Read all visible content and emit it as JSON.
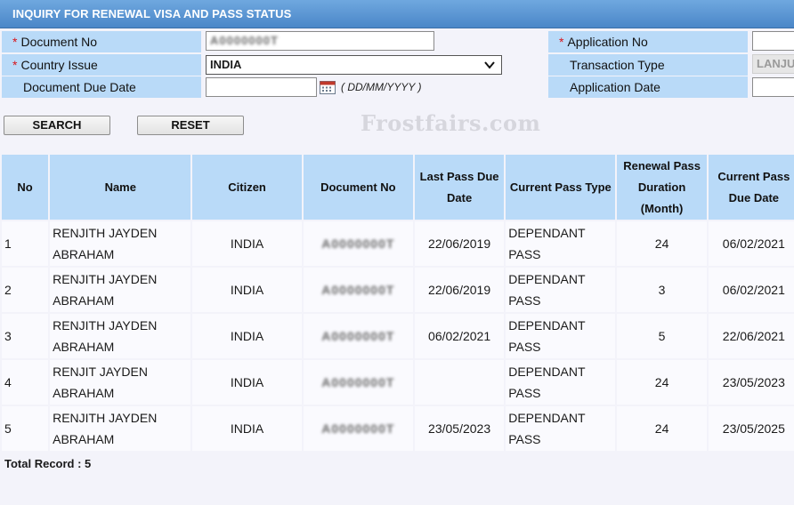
{
  "header": {
    "title": "INQUIRY FOR RENEWAL VISA AND PASS STATUS"
  },
  "form": {
    "required_mark": "*",
    "document_no": {
      "label": "Document No",
      "value": "A0000000T"
    },
    "country_issue": {
      "label": "Country Issue",
      "value": "INDIA"
    },
    "document_due_date": {
      "label": "Document Due Date",
      "value": "",
      "hint": "( DD/MM/YYYY )"
    },
    "application_no": {
      "label": "Application No",
      "value": ""
    },
    "transaction_type": {
      "label": "Transaction Type",
      "value": "LANJU"
    },
    "application_date": {
      "label": "Application Date",
      "value": ""
    }
  },
  "buttons": {
    "search": "SEARCH",
    "reset": "RESET"
  },
  "watermark": "Frostfairs.com",
  "table": {
    "headers": {
      "no": "No",
      "name": "Name",
      "citizen": "Citizen",
      "document_no": "Document No",
      "last_pass_due_date": "Last Pass Due Date",
      "current_pass_type": "Current Pass Type",
      "renewal_pass_duration": "Renewal Pass Duration (Month)",
      "current_pass_due_date": "Current Pass Due Date"
    },
    "rows": [
      {
        "no": "1",
        "name": "RENJITH JAYDEN ABRAHAM",
        "citizen": "INDIA",
        "document_no": "A0000000T",
        "last_due": "22/06/2019",
        "type": "DEPENDANT PASS",
        "duration": "24",
        "current_due": "06/02/2021"
      },
      {
        "no": "2",
        "name": "RENJITH JAYDEN ABRAHAM",
        "citizen": "INDIA",
        "document_no": "A0000000T",
        "last_due": "22/06/2019",
        "type": "DEPENDANT PASS",
        "duration": "3",
        "current_due": "06/02/2021"
      },
      {
        "no": "3",
        "name": "RENJITH JAYDEN ABRAHAM",
        "citizen": "INDIA",
        "document_no": "A0000000T",
        "last_due": "06/02/2021",
        "type": "DEPENDANT PASS",
        "duration": "5",
        "current_due": "22/06/2021"
      },
      {
        "no": "4",
        "name": "RENJIT JAYDEN ABRAHAM",
        "citizen": "INDIA",
        "document_no": "A0000000T",
        "last_due": "",
        "type": "DEPENDANT PASS",
        "duration": "24",
        "current_due": "23/05/2023"
      },
      {
        "no": "5",
        "name": "RENJITH JAYDEN ABRAHAM",
        "citizen": "INDIA",
        "document_no": "A0000000T",
        "last_due": "23/05/2023",
        "type": "DEPENDANT PASS",
        "duration": "24",
        "current_due": "23/05/2025"
      }
    ]
  },
  "footer": {
    "total_record": "Total Record : 5"
  }
}
